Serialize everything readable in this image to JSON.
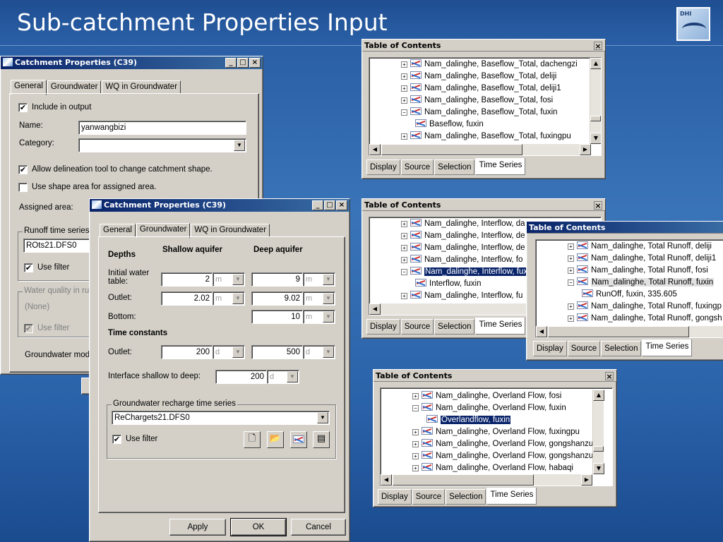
{
  "slide": {
    "title": "Sub-catchment Properties Input",
    "logo_text": "DHI"
  },
  "cp_back": {
    "title": "Catchment Properties (C39)",
    "tabs": [
      "General",
      "Groundwater",
      "WQ in Groundwater"
    ],
    "include_label": "Include in output",
    "include_checked": "✔",
    "name_label": "Name:",
    "name_value": "yanwangbizi",
    "category_label": "Category:",
    "category_value": "",
    "allow_label": "Allow delineation tool to change catchment shape.",
    "allow_checked": "✔",
    "useshape_label": "Use shape area for assigned area.",
    "useshape_checked": "",
    "assigned_label": "Assigned area:",
    "runoff_group": "Runoff time series",
    "runoff_value": "ROts21.DFS0",
    "usefilter_label": "Use filter",
    "usefilter_checked": "✔",
    "wq_group": "Water quality in ru",
    "wq_value": "(None)",
    "wq_filter_label": "Use filter",
    "wq_filter_checked": "✔",
    "gw_model_label": "Groundwater mod"
  },
  "cp_front": {
    "title": "Catchment Properties (C39)",
    "tabs": [
      "General",
      "Groundwater",
      "WQ in Groundwater"
    ],
    "depths_header": "Depths",
    "shallow_header": "Shallow aquifer",
    "deep_header": "Deep aquifer",
    "initial_label": "Initial water\ntable:",
    "initial_shallow": "2",
    "initial_deep": "9",
    "unit_m": "m",
    "outlet_label": "Outlet:",
    "outlet_shallow": "2.02",
    "outlet_deep": "9.02",
    "bottom_label": "Bottom:",
    "bottom_deep": "10",
    "timeconst_header": "Time constants",
    "tc_outlet_label": "Outlet:",
    "tc_shallow": "200",
    "tc_deep": "500",
    "unit_d": "d",
    "interface_label": "Interface shallow to deep:",
    "interface_value": "200",
    "recharge_group": "Groundwater recharge time series",
    "recharge_value": "ReChargets21.DFS0",
    "usefilter_label": "Use filter",
    "usefilter_checked": "✔",
    "apply": "Apply",
    "ok": "OK",
    "cancel": "Cancel"
  },
  "toc_common": {
    "title": "Table of Contents",
    "close": "×",
    "tabs": [
      "Display",
      "Source",
      "Selection",
      "Time Series"
    ]
  },
  "toc1": {
    "rows": [
      {
        "exp": "+",
        "text": "Nam_dalinghe, Baseflow_Total, dachengzi"
      },
      {
        "exp": "+",
        "text": "Nam_dalinghe, Baseflow_Total, deliji"
      },
      {
        "exp": "+",
        "text": "Nam_dalinghe, Baseflow_Total, deliji1"
      },
      {
        "exp": "+",
        "text": "Nam_dalinghe, Baseflow_Total, fosi"
      },
      {
        "exp": "−",
        "text": "Nam_dalinghe, Baseflow_Total, fuxin"
      },
      {
        "exp": "",
        "text": "Baseflow, fuxin"
      },
      {
        "exp": "+",
        "text": "Nam_dalinghe, Baseflow_Total, fuxingpu"
      }
    ]
  },
  "toc2": {
    "rows": [
      {
        "exp": "+",
        "text": "Nam_dalinghe, Interflow, da"
      },
      {
        "exp": "+",
        "text": "Nam_dalinghe, Interflow, de"
      },
      {
        "exp": "+",
        "text": "Nam_dalinghe, Interflow, de"
      },
      {
        "exp": "+",
        "text": "Nam_dalinghe, Interflow, fo"
      },
      {
        "exp": "−",
        "text": "Nam_dalinghe, Interflow, fux"
      },
      {
        "exp": "",
        "text": "Interflow, fuxin"
      },
      {
        "exp": "+",
        "text": "Nam_dalinghe, Interflow, fu"
      }
    ]
  },
  "toc3": {
    "rows": [
      {
        "exp": "+",
        "text": "Nam_dalinghe, Total Runoff, deliji"
      },
      {
        "exp": "+",
        "text": "Nam_dalinghe, Total Runoff, deliji1"
      },
      {
        "exp": "+",
        "text": "Nam_dalinghe, Total Runoff, fosi"
      },
      {
        "exp": "−",
        "text": "Nam_dalinghe, Total Runoff, fuxin"
      },
      {
        "exp": "",
        "text": "RunOff, fuxin, 335.605"
      },
      {
        "exp": "+",
        "text": "Nam_dalinghe, Total Runoff, fuxingp"
      },
      {
        "exp": "+",
        "text": "Nam_dalinghe, Total Runoff, gongsh"
      }
    ]
  },
  "toc4": {
    "rows": [
      {
        "exp": "+",
        "text": "Nam_dalinghe, Overland Flow, fosi"
      },
      {
        "exp": "−",
        "text": "Nam_dalinghe, Overland Flow, fuxin"
      },
      {
        "exp": "",
        "text": "Overlandflow, fuxin"
      },
      {
        "exp": "+",
        "text": "Nam_dalinghe, Overland Flow, fuxingpu"
      },
      {
        "exp": "+",
        "text": "Nam_dalinghe, Overland Flow, gongshanzu"
      },
      {
        "exp": "+",
        "text": "Nam_dalinghe, Overland Flow, gongshanzu"
      },
      {
        "exp": "+",
        "text": "Nam_dalinghe, Overland Flow, habaqi"
      }
    ]
  }
}
